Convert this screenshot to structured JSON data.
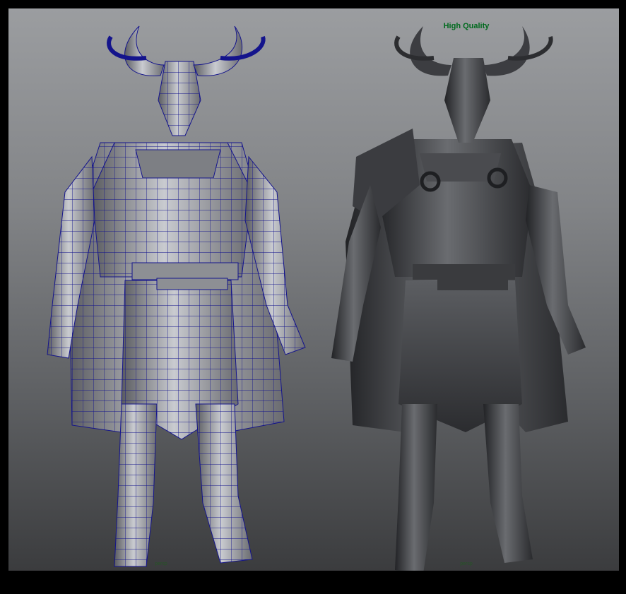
{
  "viewports": {
    "left": {
      "label": "",
      "hud": "persp",
      "mode": "wireframe-on-shaded"
    },
    "right": {
      "label": "High Quality",
      "hud": "persp",
      "mode": "shaded"
    }
  },
  "colors": {
    "background_top": "#9b9da0",
    "background_bottom": "#3b3c3e",
    "wireframe": "#14148c",
    "label_green": "#006a1e"
  },
  "icons": {
    "left_model": "armored-knight-wireframe",
    "right_model": "armored-knight-sculpt"
  }
}
